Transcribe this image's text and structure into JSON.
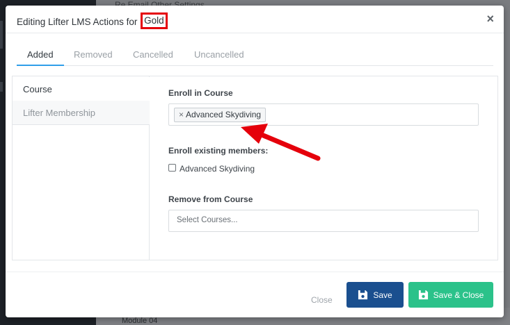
{
  "background": {
    "top_text": "Re                                      Email                       Other Settings",
    "bottom_text": "Module 04"
  },
  "modal": {
    "title_prefix": "Editing Lifter LMS Actions for ",
    "title_highlight": "Gold",
    "close_symbol": "×"
  },
  "tabs": [
    {
      "label": "Added",
      "active": true
    },
    {
      "label": "Removed",
      "active": false
    },
    {
      "label": "Cancelled",
      "active": false
    },
    {
      "label": "Uncancelled",
      "active": false
    }
  ],
  "side_nav": [
    {
      "label": "Course",
      "active": true
    },
    {
      "label": "Lifter Membership",
      "active": false
    }
  ],
  "form": {
    "enroll_label": "Enroll in Course",
    "enroll_selected": [
      {
        "label": "Advanced Skydiving",
        "remove_symbol": "×"
      }
    ],
    "existing_label": "Enroll existing members:",
    "existing_checkbox_label": "Advanced Skydiving",
    "existing_checked": false,
    "remove_label": "Remove from Course",
    "remove_placeholder": "Select Courses..."
  },
  "footer": {
    "close_label": "Close",
    "save_label": "Save",
    "save_close_label": "Save & Close"
  },
  "colors": {
    "accent_tab": "#2f9ee9",
    "save_button": "#1a4f8f",
    "save_close_button": "#2bc28a",
    "annotation": "#e5000b"
  },
  "icons": {
    "save": "floppy-disk-icon",
    "close": "close-icon",
    "annotation": "arrow-annotation"
  }
}
